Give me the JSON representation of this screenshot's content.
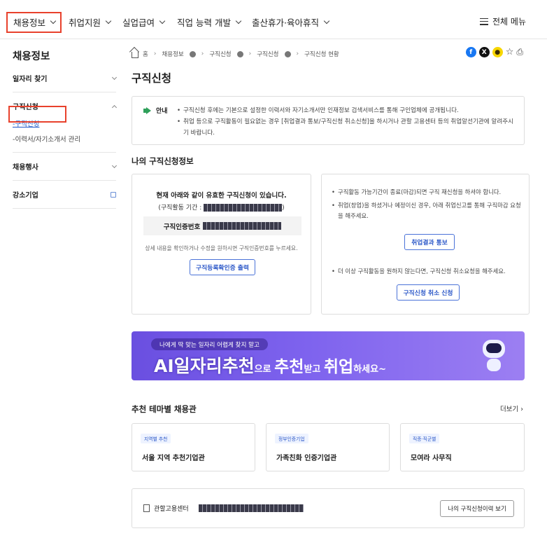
{
  "topnav": {
    "items": [
      "채용정보",
      "취업지원",
      "실업급여",
      "직업 능력 개발",
      "출산휴가·육아휴직"
    ],
    "all_menu": "전체 메뉴"
  },
  "sidebar": {
    "title": "채용정보",
    "items": [
      {
        "label": "일자리 찾기"
      },
      {
        "label": "구직신청",
        "sub": [
          "구직신청",
          "이력서/자기소개서 관리"
        ]
      },
      {
        "label": "채용행사"
      },
      {
        "label": "강소기업"
      }
    ]
  },
  "breadcrumb": [
    "홈",
    "채용정보",
    "구직신청",
    "구직신청",
    "구직신청 현황"
  ],
  "share_icons": [
    "facebook-icon",
    "x-icon",
    "kakao-icon",
    "star-icon",
    "print-icon"
  ],
  "page_title": "구직신청",
  "notice": {
    "label": "안내",
    "lines": [
      "구직신청 후에는 기본으로 설정한 이력서와 자기소개서만 인재정보 검색서비스를 통해 구인업체에 공개됩니다.",
      "취업 등으로 구직활동이 필요없는 경우 [취업결과 통보/구직신청 취소신청]을 하시거나 관할 고용센터 등의 취업알선기관에 알려주시기 바랍니다."
    ]
  },
  "my_info": {
    "title": "나의 구직신청정보",
    "valid_text": "현재 아래와 같이 유효한 구직신청이 있습니다.",
    "period_label": "(구직활동 기간 :",
    "period_end": ")",
    "id_label": "구직인증번호",
    "hint": "상세 내용을 확인하거나 수정을 원하시면 구직인증번호를 누르세요.",
    "print_button": "구직등록확인증 출력",
    "right_line1": "구직활동 가능기간이 종료(마감)되면 구직 재신청을 하셔야 합니다.",
    "right_line2": "취업(창업)을 하셨거나 예정이신 경우, 아래 취업신고를 통해 구직마감 요청을 해주세요.",
    "report_button": "취업결과 통보",
    "right_line3": "더 이상 구직활동을 원하지 않는다면, 구직신청 취소요청을 해주세요.",
    "cancel_button": "구직신청 취소 신청"
  },
  "banner": {
    "pill": "나에게 딱 맞는 일자리 어렵게 찾지 말고",
    "part1": "AI일자리추천",
    "part2": "으로 ",
    "part3": "추천",
    "part4": "받고 ",
    "part5": "취업",
    "part6": "하세요~"
  },
  "themes": {
    "title": "추천 테마별 채용관",
    "more": "더보기",
    "cards": [
      {
        "tag": "지역별 추천",
        "title": "서울 지역 추천기업관"
      },
      {
        "tag": "정부인증기업",
        "title": "가족친화 인증기업관"
      },
      {
        "tag": "직종·직군별",
        "title": "모여라 사무직"
      }
    ]
  },
  "office": {
    "label": "관할고용센터",
    "history_button": "나의 구직신청이력 보기"
  },
  "colors": {
    "highlight": "#e8412c",
    "accent": "#2c58c8",
    "banner": "#7e63ee"
  }
}
